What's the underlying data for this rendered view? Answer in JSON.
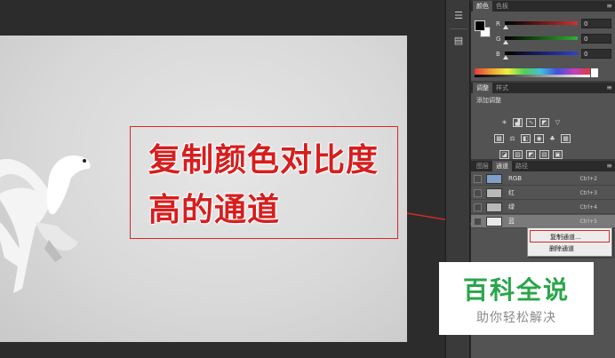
{
  "callout": {
    "line1": "复制颜色对比度",
    "line2": "高的通道"
  },
  "color_panel": {
    "tabs": [
      "颜色",
      "色板"
    ],
    "sliders": [
      {
        "label": "R",
        "value": "0",
        "color": "#d03030"
      },
      {
        "label": "G",
        "value": "0",
        "color": "#30b030"
      },
      {
        "label": "B",
        "value": "0",
        "color": "#3040d0"
      }
    ]
  },
  "adjustments_panel": {
    "tabs": [
      "调整",
      "样式"
    ],
    "title": "添加调整",
    "icon_rows": [
      [
        "sun-icon",
        "levels-icon",
        "curves-icon",
        "exposure-icon",
        "gradient-triangle-icon"
      ],
      [
        "vibrance-icon",
        "balance-icon",
        "bw-icon",
        "photo-filter-icon",
        "channel-mixer-icon",
        "lookup-icon"
      ],
      [
        "invert-icon",
        "posterize-icon",
        "threshold-icon",
        "gradient-map-icon",
        "selective-color-icon"
      ]
    ]
  },
  "channels_panel": {
    "tabs": [
      "图层",
      "通道",
      "路径"
    ],
    "rows": [
      {
        "name": "RGB",
        "shortcut": "Ctrl+2"
      },
      {
        "name": "红",
        "shortcut": "Ctrl+3"
      },
      {
        "name": "绿",
        "shortcut": "Ctrl+4"
      },
      {
        "name": "蓝",
        "shortcut": "Ctrl+5"
      }
    ]
  },
  "context_menu": {
    "items": [
      "复制通道...",
      "删除通道"
    ]
  },
  "watermark": {
    "title": "百科全说",
    "subtitle": "助你轻松解决"
  },
  "colors": {
    "accent_red": "#d22a2a",
    "watermark_green": "#2aa64a"
  }
}
